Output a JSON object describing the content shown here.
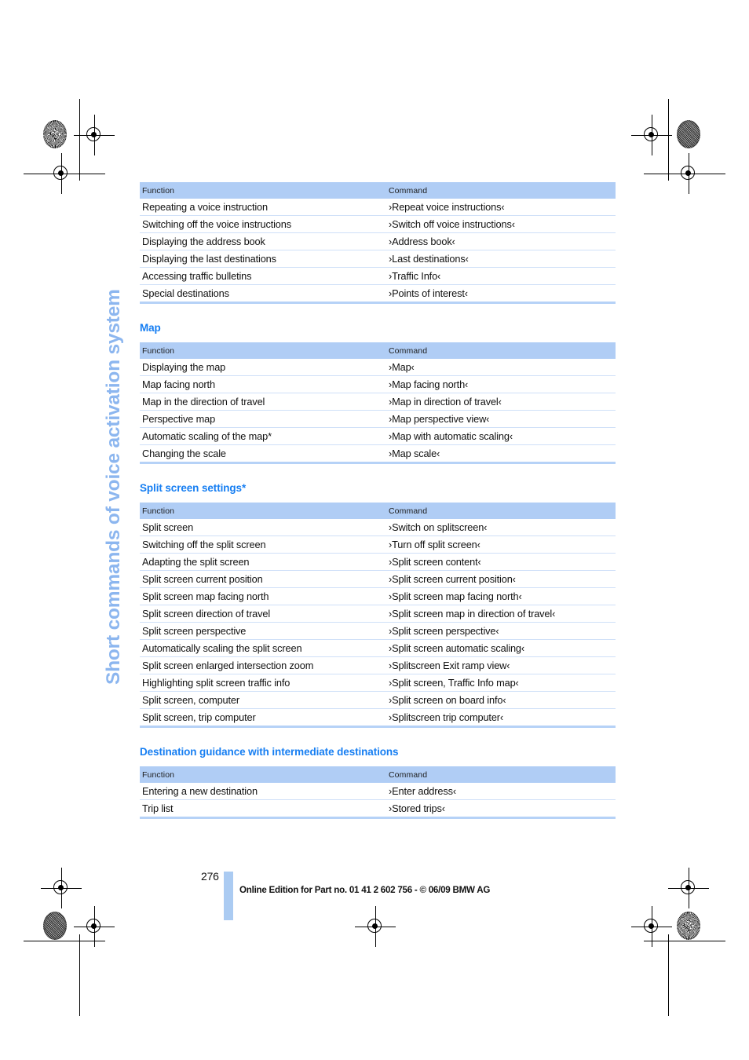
{
  "page": {
    "running_title": "Short commands of voice activation system",
    "page_number": "276",
    "footer_note": "Online Edition for Part no. 01 41 2 602 756 - © 06/09 BMW AG",
    "accent_heading_color": "#167ef2",
    "table_header_color": "#b0cdf5",
    "running_title_color": "#8cb6ef"
  },
  "columns": {
    "function": "Function",
    "command": "Command"
  },
  "sections": [
    {
      "heading": null,
      "rows": [
        {
          "function": "Repeating a voice instruction",
          "command": "›Repeat voice instructions‹"
        },
        {
          "function": "Switching off the voice instructions",
          "command": "›Switch off voice instructions‹"
        },
        {
          "function": "Displaying the address book",
          "command": "›Address book‹"
        },
        {
          "function": "Displaying the last destinations",
          "command": "›Last destinations‹"
        },
        {
          "function": "Accessing traffic bulletins",
          "command": "›Traffic Info‹"
        },
        {
          "function": "Special destinations",
          "command": "›Points of interest‹"
        }
      ]
    },
    {
      "heading": "Map",
      "rows": [
        {
          "function": "Displaying the map",
          "command": "›Map‹"
        },
        {
          "function": "Map facing north",
          "command": "›Map facing north‹"
        },
        {
          "function": "Map in the direction of travel",
          "command": "›Map in direction of travel‹"
        },
        {
          "function": "Perspective map",
          "command": "›Map perspective view‹"
        },
        {
          "function": "Automatic scaling of the map*",
          "command": "›Map with automatic scaling‹"
        },
        {
          "function": "Changing the scale",
          "command": "›Map scale‹"
        }
      ]
    },
    {
      "heading": "Split screen settings*",
      "rows": [
        {
          "function": "Split screen",
          "command": "›Switch on splitscreen‹"
        },
        {
          "function": "Switching off the split screen",
          "command": "›Turn off split screen‹"
        },
        {
          "function": "Adapting the split screen",
          "command": "›Split screen content‹"
        },
        {
          "function": "Split screen current position",
          "command": "›Split screen current position‹"
        },
        {
          "function": "Split screen map facing north",
          "command": "›Split screen map facing north‹"
        },
        {
          "function": "Split screen direction of travel",
          "command": "›Split screen map in direction of travel‹"
        },
        {
          "function": "Split screen perspective",
          "command": "›Split screen perspective‹"
        },
        {
          "function": "Automatically scaling the split screen",
          "command": "›Split screen automatic scaling‹"
        },
        {
          "function": "Split screen enlarged intersection zoom",
          "command": "›Splitscreen Exit ramp view‹"
        },
        {
          "function": "Highlighting split screen traffic info",
          "command": "›Split screen, Traffic Info map‹"
        },
        {
          "function": "Split screen, computer",
          "command": "›Split screen on board info‹"
        },
        {
          "function": "Split screen, trip computer",
          "command": "›Splitscreen trip computer‹"
        }
      ]
    },
    {
      "heading": "Destination guidance with intermediate destinations",
      "rows": [
        {
          "function": "Entering a new destination",
          "command": "›Enter address‹"
        },
        {
          "function": "Trip list",
          "command": "›Stored trips‹"
        }
      ]
    }
  ]
}
